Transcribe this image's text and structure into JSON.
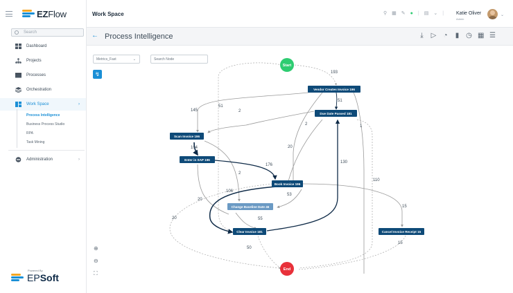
{
  "app": {
    "brand_bold": "EZ",
    "brand_rest": "Flow"
  },
  "sidebar": {
    "search_placeholder": "Search",
    "items": [
      {
        "label": "Dashboard"
      },
      {
        "label": "Projects"
      },
      {
        "label": "Processes"
      },
      {
        "label": "Orchestration"
      },
      {
        "label": "Work Space"
      },
      {
        "label": "Administration"
      }
    ],
    "subitems": [
      {
        "label": "Process Intelligence"
      },
      {
        "label": "Business Process Studio"
      },
      {
        "label": "RPA"
      },
      {
        "label": "Task Mining"
      }
    ],
    "powered_by": "Powered By",
    "footer_brand_a": "EP",
    "footer_brand_b": "Soft"
  },
  "header": {
    "title": "Work Space",
    "user_name": "Katie Oliver",
    "user_role": "Admin"
  },
  "page": {
    "title": "Process Intelligence"
  },
  "controls": {
    "metrics_value": "Metrics_Fast",
    "search_placeholder": "Search Node"
  },
  "colors": {
    "accent": "#1a8fd6",
    "node_dark": "#0e4a78",
    "node_light": "#6b9ac4",
    "start": "#2ecc71",
    "end": "#e8313a"
  },
  "graph": {
    "start_label": "Start",
    "end_label": "End",
    "nodes": [
      {
        "id": "vendor",
        "label": "Vendor Creates Invoice 196"
      },
      {
        "id": "due",
        "label": "Due Date Passed 181"
      },
      {
        "id": "scan",
        "label": "Scan Invoice 196"
      },
      {
        "id": "enter",
        "label": "Enter in SAP 196"
      },
      {
        "id": "book",
        "label": "Book Invoice 196"
      },
      {
        "id": "baseline",
        "label": "Change Baseline Date 46"
      },
      {
        "id": "clear",
        "label": "Clear Invoice 181"
      },
      {
        "id": "cancel",
        "label": "Cancel Invoice Receipt 15"
      }
    ],
    "edge_labels": [
      "193",
      "51",
      "145",
      "2",
      "51",
      "2",
      "20",
      "1",
      "104",
      "176",
      "130",
      "2",
      "110",
      "106",
      "53",
      "20",
      "15",
      "20",
      "55",
      "50",
      "15"
    ]
  }
}
